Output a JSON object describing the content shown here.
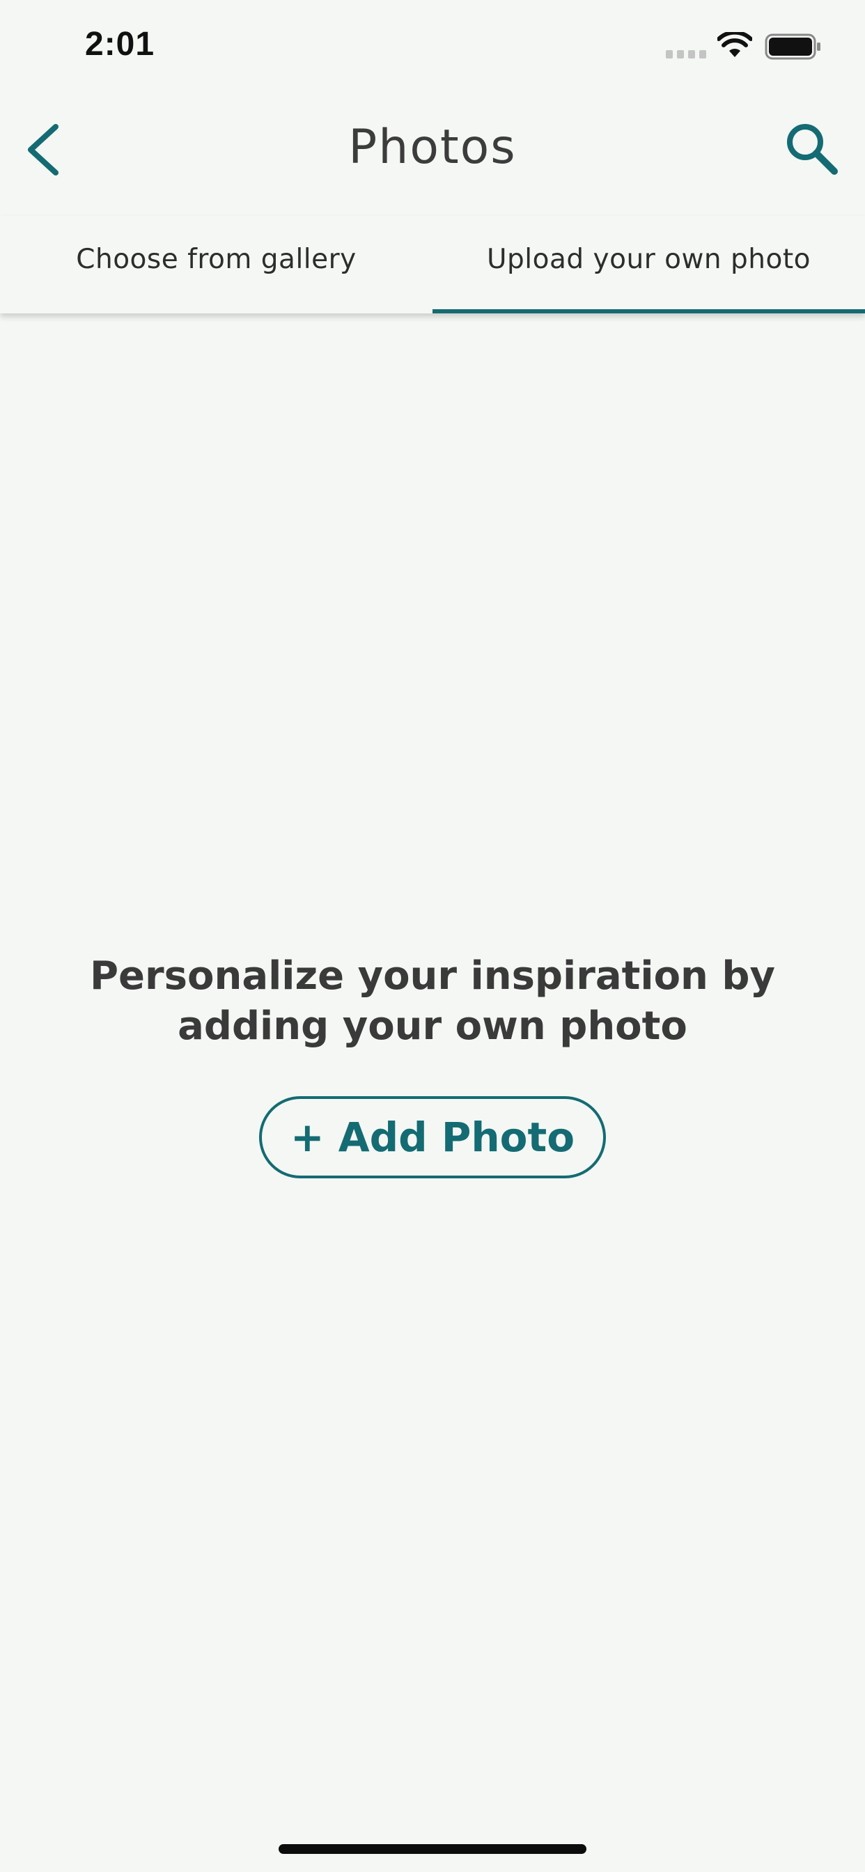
{
  "status_bar": {
    "time": "2:01"
  },
  "nav": {
    "title": "Photos",
    "back_icon": "chevron-left-icon",
    "search_icon": "search-icon"
  },
  "tabs": [
    {
      "label": "Choose from gallery",
      "active": false
    },
    {
      "label": "Upload your own photo",
      "active": true
    }
  ],
  "empty_state": {
    "message": "Personalize your inspiration by adding your own photo",
    "button_label": "+ Add Photo"
  },
  "colors": {
    "accent": "#146b73",
    "background": "#f4f7f3",
    "text": "#3a3a3a"
  }
}
